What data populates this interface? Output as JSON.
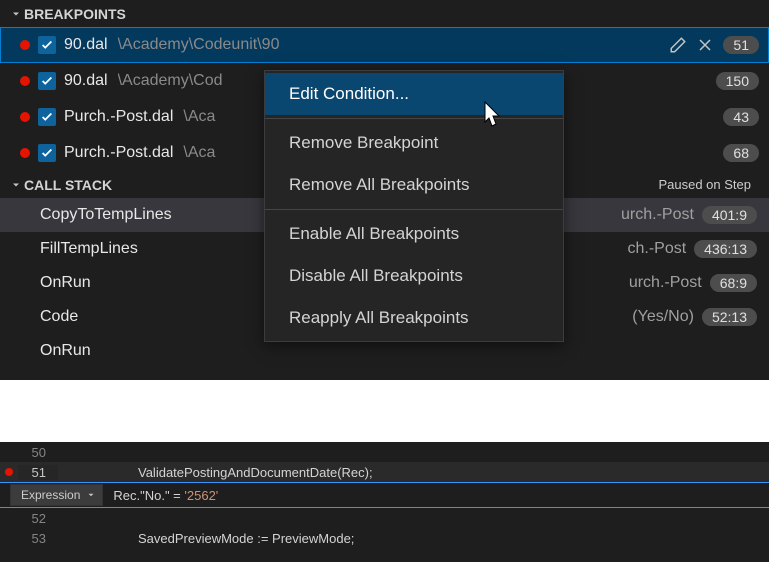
{
  "breakpoints": {
    "title": "BREAKPOINTS",
    "items": [
      {
        "name": "90.dal",
        "path": "\\Academy\\Codeunit\\90",
        "line": "51",
        "selected": true,
        "showActions": true
      },
      {
        "name": "90.dal",
        "path": "\\Academy\\Cod",
        "line": "150"
      },
      {
        "name": "Purch.-Post.dal",
        "path": "\\Aca",
        "line": "43"
      },
      {
        "name": "Purch.-Post.dal",
        "path": "\\Aca",
        "line": "68"
      }
    ]
  },
  "callstack": {
    "title": "CALL STACK",
    "status": "Paused on Step",
    "frames": [
      {
        "name": "CopyToTempLines",
        "loc": "urch.-Post",
        "pos": "401:9",
        "selected": true
      },
      {
        "name": "FillTempLines",
        "loc": "ch.-Post",
        "pos": "436:13"
      },
      {
        "name": "OnRun",
        "loc": "urch.-Post",
        "pos": "68:9"
      },
      {
        "name": "Code",
        "loc": "(Yes/No)",
        "pos": "52:13"
      },
      {
        "name": "OnRun",
        "loc": "",
        "pos": ""
      }
    ]
  },
  "menu": {
    "items": [
      {
        "label": "Edit Condition...",
        "highlight": true
      },
      {
        "sep": true
      },
      {
        "label": "Remove Breakpoint"
      },
      {
        "label": "Remove All Breakpoints"
      },
      {
        "sep": true
      },
      {
        "label": "Enable All Breakpoints"
      },
      {
        "label": "Disable All Breakpoints"
      },
      {
        "label": "Reapply All Breakpoints"
      }
    ]
  },
  "editor": {
    "lines": [
      {
        "num": "50",
        "code": ""
      },
      {
        "num": "51",
        "code": "ValidatePostingAndDocumentDate(Rec);",
        "current": true,
        "bp": true
      },
      {
        "cond": true,
        "dropdown": "Expression",
        "expr_pre": "Rec.\"No.\" = ",
        "expr_str": "'2562'"
      },
      {
        "num": "52",
        "code": ""
      },
      {
        "num": "53",
        "code": "SavedPreviewMode := PreviewMode;"
      }
    ]
  }
}
